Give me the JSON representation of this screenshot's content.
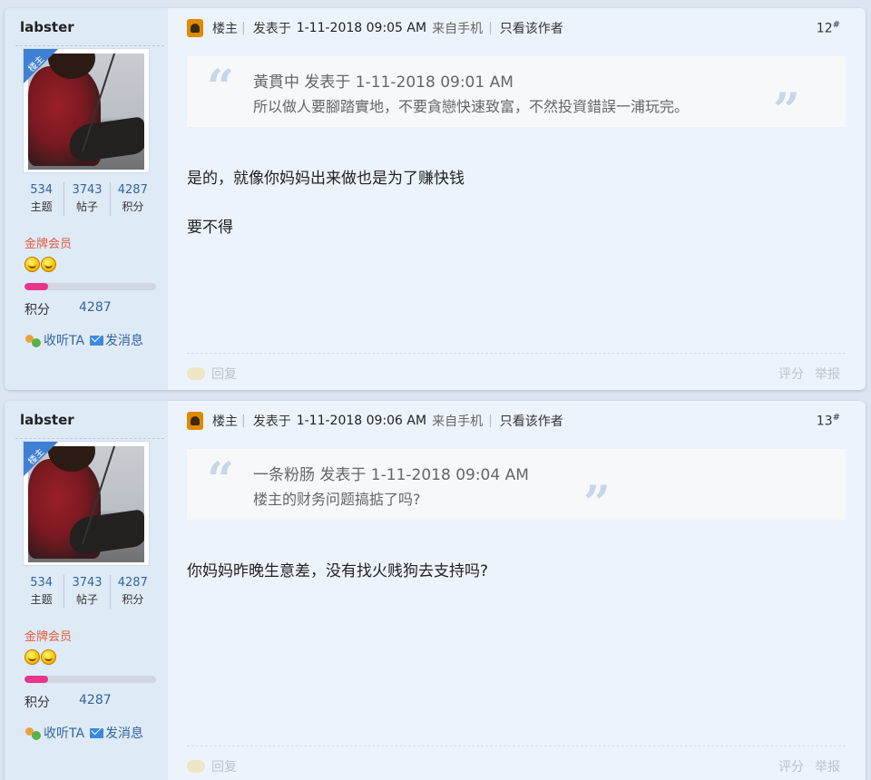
{
  "posts": [
    {
      "author": "labster",
      "badge": "楼主",
      "stats": [
        {
          "value": "534",
          "label": "主题"
        },
        {
          "value": "3743",
          "label": "帖子"
        },
        {
          "value": "4287",
          "label": "积分"
        }
      ],
      "rank": "金牌会员",
      "progress_fraction": 0.18,
      "score_label": "积分",
      "score_value": "4287",
      "follow_label": "收听TA",
      "message_label": "发消息",
      "role": "楼主",
      "posted_prefix": "发表于",
      "posted_time": "1-11-2018 09:05 AM",
      "posted_from": "来自手机",
      "only_author_label": "只看该作者",
      "floor": "12",
      "floor_mark": "#",
      "quote": {
        "meta": "黃貫中 发表于 1-11-2018 09:01 AM",
        "text": "所以做人要腳踏實地，不要貪戀快速致富，不然投資錯誤一浦玩完。"
      },
      "content": [
        "是的，就像你妈妈出来做也是为了赚快钱",
        "要不得"
      ],
      "reply_label": "回复",
      "rate_label": "评分",
      "report_label": "举报"
    },
    {
      "author": "labster",
      "badge": "楼主",
      "stats": [
        {
          "value": "534",
          "label": "主题"
        },
        {
          "value": "3743",
          "label": "帖子"
        },
        {
          "value": "4287",
          "label": "积分"
        }
      ],
      "rank": "金牌会员",
      "progress_fraction": 0.18,
      "score_label": "积分",
      "score_value": "4287",
      "follow_label": "收听TA",
      "message_label": "发消息",
      "role": "楼主",
      "posted_prefix": "发表于",
      "posted_time": "1-11-2018 09:06 AM",
      "posted_from": "来自手机",
      "only_author_label": "只看该作者",
      "floor": "13",
      "floor_mark": "#",
      "quote": {
        "meta": "一条粉肠 发表于 1-11-2018 09:04 AM",
        "text": "楼主的财务问题搞掂了吗?"
      },
      "content": [
        "你妈妈昨晚生意差，没有找火贱狗去支持吗?"
      ],
      "reply_label": "回复",
      "rate_label": "评分",
      "report_label": "举报"
    }
  ],
  "colors": {
    "page_bg": "#dbe6f1",
    "sidebar_bg": "#dfeaf7",
    "link": "#336699",
    "rank": "#e55a3a",
    "progress": "#e8358a",
    "badge": "#3f80d4"
  }
}
